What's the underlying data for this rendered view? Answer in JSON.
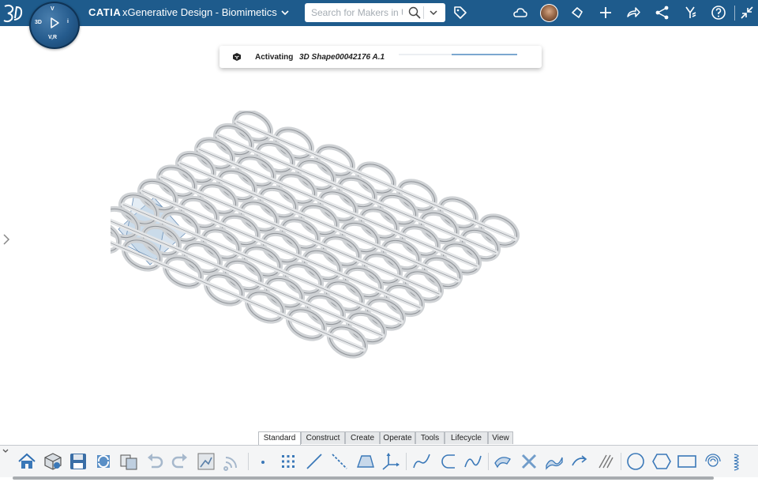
{
  "app": {
    "brand": "CATIA",
    "title": "xGenerative Design - Biomimetics"
  },
  "compass": {
    "top": "V",
    "left": "3D",
    "right": "i",
    "bottom": "V,R"
  },
  "search": {
    "placeholder": "Search for Makers in US"
  },
  "notification": {
    "label": "Activating",
    "item": "3D Shape00042176 A.1",
    "progress": 0.55
  },
  "tabs": [
    {
      "label": "Standard",
      "active": true
    },
    {
      "label": "Construct",
      "active": false
    },
    {
      "label": "Create",
      "active": false
    },
    {
      "label": "Operate",
      "active": false
    },
    {
      "label": "Tools",
      "active": false
    },
    {
      "label": "Lifecycle",
      "active": false
    },
    {
      "label": "View",
      "active": false
    }
  ],
  "colors": {
    "topbar": "#1e5b8c",
    "accent": "#2f6fb3",
    "toolbar_icon": "#3a78b8"
  },
  "toolbar_icons": [
    "tag-icon",
    "cloud-icon",
    "avatar",
    "share-app-icon",
    "plus-icon",
    "forward-icon",
    "share-network-icon",
    "compass-tools-icon",
    "help-icon",
    "collapse-icon"
  ],
  "action_icons": [
    "home-icon",
    "3d-part-icon",
    "save-icon",
    "refresh-icon",
    "compare-icon",
    "undo-icon",
    "redo-icon",
    "snapshot-icon",
    "signal-icon",
    "point-icon",
    "point-grid-icon",
    "line-icon",
    "dashed-line-icon",
    "plane-icon",
    "axis-system-icon",
    "polyline-icon",
    "arc-icon",
    "spline-icon",
    "sweep-icon",
    "twist-icon",
    "wave-sweep-icon",
    "repeat-icon",
    "parallel-curves-icon",
    "circle-icon",
    "hexagon-icon",
    "rectangle-icon",
    "spiral-icon",
    "helix-icon"
  ]
}
